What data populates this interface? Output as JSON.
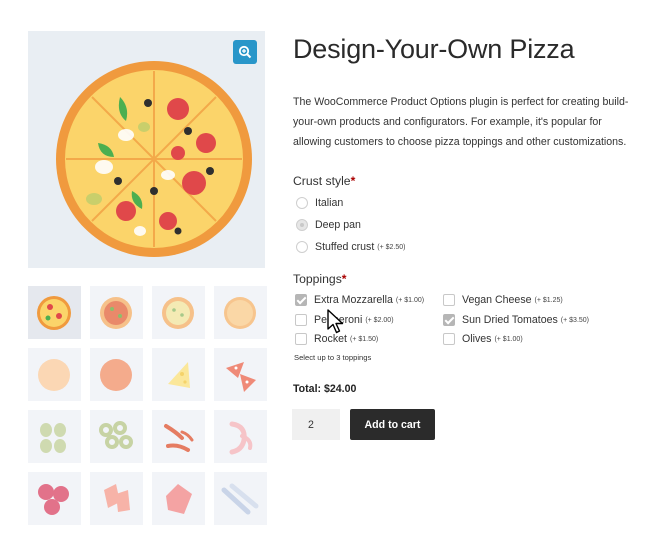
{
  "product": {
    "title": "Design-Your-Own Pizza",
    "description": "The WooCommerce Product Options plugin is perfect for creating build-your-own products and configurators. For example, it's popular for allowing customers to choose pizza toppings and other customizations."
  },
  "gallery": {
    "zoom_icon": "zoom-in-icon",
    "thumbnails": [
      {
        "name": "pizza"
      },
      {
        "name": "pizza-sauce"
      },
      {
        "name": "pizza-cheese"
      },
      {
        "name": "pizza-base"
      },
      {
        "name": "dough-ball"
      },
      {
        "name": "tomato-base"
      },
      {
        "name": "cheese-slices"
      },
      {
        "name": "pepperoni-pieces"
      },
      {
        "name": "olives"
      },
      {
        "name": "onion-rings"
      },
      {
        "name": "chili-peppers"
      },
      {
        "name": "prawns"
      },
      {
        "name": "salami"
      },
      {
        "name": "bacon"
      },
      {
        "name": "ham"
      },
      {
        "name": "anchovies"
      }
    ]
  },
  "crust": {
    "label": "Crust style",
    "required_mark": "*",
    "options": [
      {
        "label": "Italian",
        "price": "",
        "checked": false
      },
      {
        "label": "Deep pan",
        "price": "",
        "checked": true
      },
      {
        "label": "Stuffed crust",
        "price": "(+ $2.50)",
        "checked": false
      }
    ]
  },
  "toppings": {
    "label": "Toppings",
    "required_mark": "*",
    "options": [
      {
        "label": "Extra Mozzarella",
        "price": "(+ $1.00)",
        "checked": true
      },
      {
        "label": "Pepperoni",
        "price": "(+ $2.00)",
        "checked": false
      },
      {
        "label": "Rocket",
        "price": "(+ $1.50)",
        "checked": false
      },
      {
        "label": "Vegan Cheese",
        "price": "(+ $1.25)",
        "checked": false
      },
      {
        "label": "Sun Dried Tomatoes",
        "price": "(+ $3.50)",
        "checked": true
      },
      {
        "label": "Olives",
        "price": "(+ $1.00)",
        "checked": false
      }
    ],
    "hint": "Select up to 3 toppings"
  },
  "cart": {
    "total": "Total: $24.00",
    "quantity": "2",
    "add_label": "Add to cart"
  },
  "colors": {
    "accent": "#2996c9",
    "button": "#2b2b2b",
    "required": "#aa0000"
  }
}
